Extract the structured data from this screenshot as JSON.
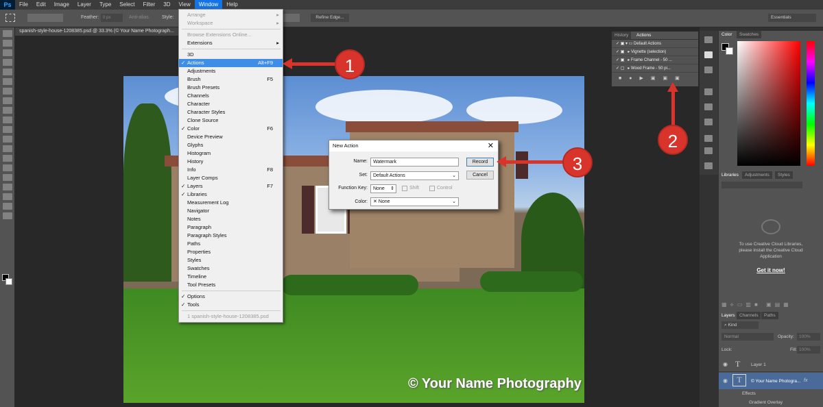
{
  "app": {
    "logo": "Ps"
  },
  "menubar": [
    "File",
    "Edit",
    "Image",
    "Layer",
    "Type",
    "Select",
    "Filter",
    "3D",
    "View",
    "Window",
    "Help"
  ],
  "options": {
    "feather_label": "Feather:",
    "feather_value": "0 px",
    "antialias": "Anti-alias",
    "style_label": "Style:",
    "refine": "Refine Edge...",
    "workspace": "Essentials"
  },
  "document": {
    "tab": "spanish-style-house-1208385.psd @ 33.3% (© Your Name Photograph..."
  },
  "watermark": "© Your Name Photography",
  "window_menu": {
    "items": [
      {
        "label": "Arrange",
        "disabled": true,
        "arrow": true
      },
      {
        "label": "Workspace",
        "disabled": true,
        "arrow": true
      },
      {
        "sep": true
      },
      {
        "label": "Browse Extensions Online...",
        "disabled": true
      },
      {
        "label": "Extensions",
        "arrow": true
      },
      {
        "sep": true
      },
      {
        "label": "3D"
      },
      {
        "label": "Actions",
        "shortcut": "Alt+F9",
        "checked": true,
        "selected": true
      },
      {
        "label": "Adjustments"
      },
      {
        "label": "Brush",
        "shortcut": "F5"
      },
      {
        "label": "Brush Presets"
      },
      {
        "label": "Channels"
      },
      {
        "label": "Character"
      },
      {
        "label": "Character Styles"
      },
      {
        "label": "Clone Source"
      },
      {
        "label": "Color",
        "shortcut": "F6",
        "checked": true
      },
      {
        "label": "Device Preview"
      },
      {
        "label": "Glyphs"
      },
      {
        "label": "Histogram"
      },
      {
        "label": "History"
      },
      {
        "label": "Info",
        "shortcut": "F8"
      },
      {
        "label": "Layer Comps"
      },
      {
        "label": "Layers",
        "shortcut": "F7",
        "checked": true
      },
      {
        "label": "Libraries",
        "checked": true
      },
      {
        "label": "Measurement Log"
      },
      {
        "label": "Navigator"
      },
      {
        "label": "Notes"
      },
      {
        "label": "Paragraph"
      },
      {
        "label": "Paragraph Styles"
      },
      {
        "label": "Paths"
      },
      {
        "label": "Properties"
      },
      {
        "label": "Styles"
      },
      {
        "label": "Swatches"
      },
      {
        "label": "Timeline"
      },
      {
        "label": "Tool Presets"
      },
      {
        "sep": true
      },
      {
        "label": "Options",
        "checked": true
      },
      {
        "label": "Tools",
        "checked": true
      },
      {
        "sep": true
      },
      {
        "label": "1 spanish-style-house-1208385.psd",
        "disabled": true
      }
    ]
  },
  "actions_panel": {
    "tabs": [
      "History",
      "Actions"
    ],
    "rows": [
      "Default Actions",
      "Vignette (selection)",
      "Frame Channel - 50 ...",
      "Wood Frame - 50 pi..."
    ]
  },
  "color_panel": {
    "tabs": [
      "Color",
      "Swatches"
    ]
  },
  "libraries_panel": {
    "tabs": [
      "Libraries",
      "Adjustments",
      "Styles"
    ],
    "message": "To use Creative Cloud Libraries, please install the Creative Cloud Application",
    "link": "Get it now!"
  },
  "layers_panel": {
    "tabs": [
      "Layers",
      "Channels",
      "Paths"
    ],
    "kind": "Kind",
    "blend": "Normal",
    "opacity_label": "Opacity:",
    "opacity": "100%",
    "lock_label": "Lock:",
    "fill_label": "Fill:",
    "fill": "100%",
    "layers": [
      "Layer 1",
      "© Your Name Photogra..."
    ],
    "effects": "Effects",
    "gradient_overlay": "Gradient Overlay"
  },
  "dialog": {
    "title": "New Action",
    "name_label": "Name:",
    "name_value": "Watermark",
    "set_label": "Set:",
    "set_value": "Default Actions",
    "fkey_label": "Function Key:",
    "fkey_value": "None",
    "shift": "Shift",
    "control": "Control",
    "color_label": "Color:",
    "color_value": "None",
    "record": "Record",
    "cancel": "Cancel"
  },
  "callouts": [
    "1",
    "2",
    "3"
  ]
}
